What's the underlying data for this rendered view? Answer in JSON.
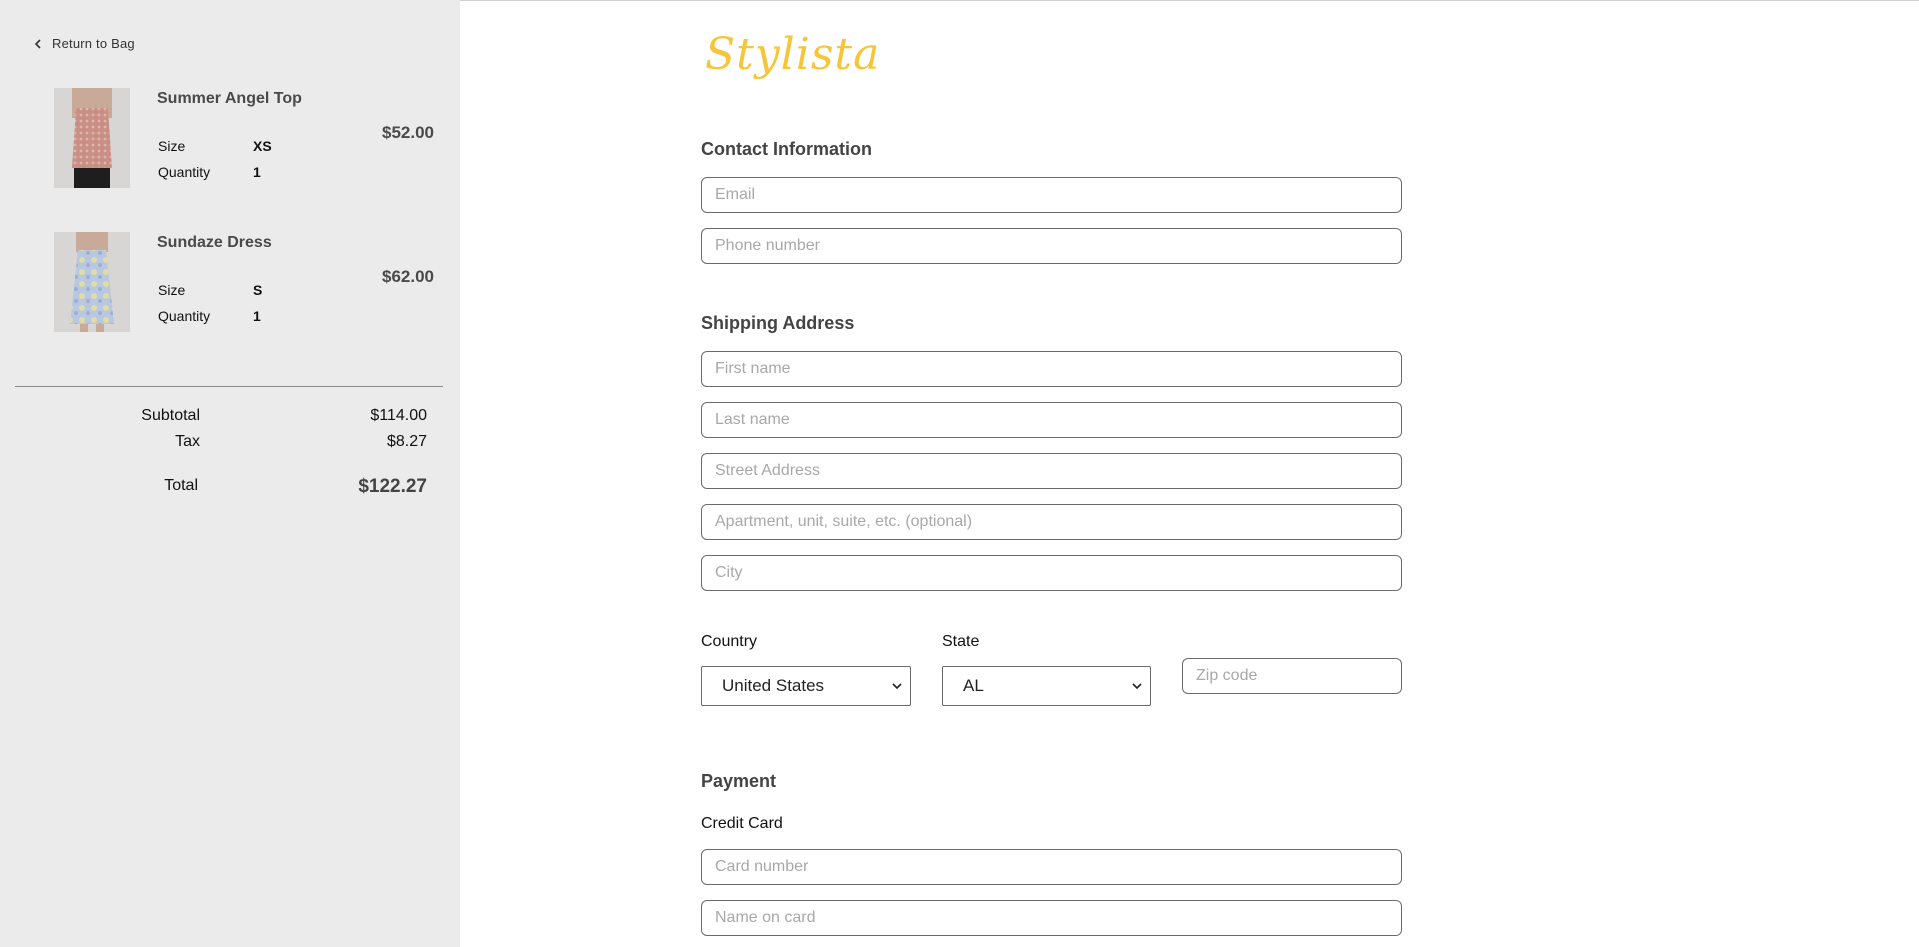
{
  "sidebar": {
    "back_label": "Return to Bag",
    "items": [
      {
        "name": "Summer Angel Top",
        "price": "$52.00",
        "size_label": "Size",
        "size": "XS",
        "qty_label": "Quantity",
        "qty": "1"
      },
      {
        "name": "Sundaze Dress",
        "price": "$62.00",
        "size_label": "Size",
        "size": "S",
        "qty_label": "Quantity",
        "qty": "1"
      }
    ],
    "summary": {
      "subtotal_label": "Subtotal",
      "subtotal": "$114.00",
      "tax_label": "Tax",
      "tax": "$8.27",
      "total_label": "Total",
      "total": "$122.27"
    }
  },
  "brand": {
    "logo": "Stylista",
    "accent": "#f5c53a"
  },
  "contact": {
    "title": "Contact Information",
    "email_placeholder": "Email",
    "phone_placeholder": "Phone number"
  },
  "shipping": {
    "title": "Shipping Address",
    "first_placeholder": "First name",
    "last_placeholder": "Last name",
    "street_placeholder": "Street Address",
    "apt_placeholder": "Apartment, unit, suite, etc. (optional)",
    "city_placeholder": "City",
    "country_label": "Country",
    "country_value": "United States",
    "state_label": "State",
    "state_value": "AL",
    "zip_placeholder": "Zip code"
  },
  "payment": {
    "title": "Payment",
    "method_label": "Credit Card",
    "card_placeholder": "Card number",
    "name_placeholder": "Name on card"
  }
}
